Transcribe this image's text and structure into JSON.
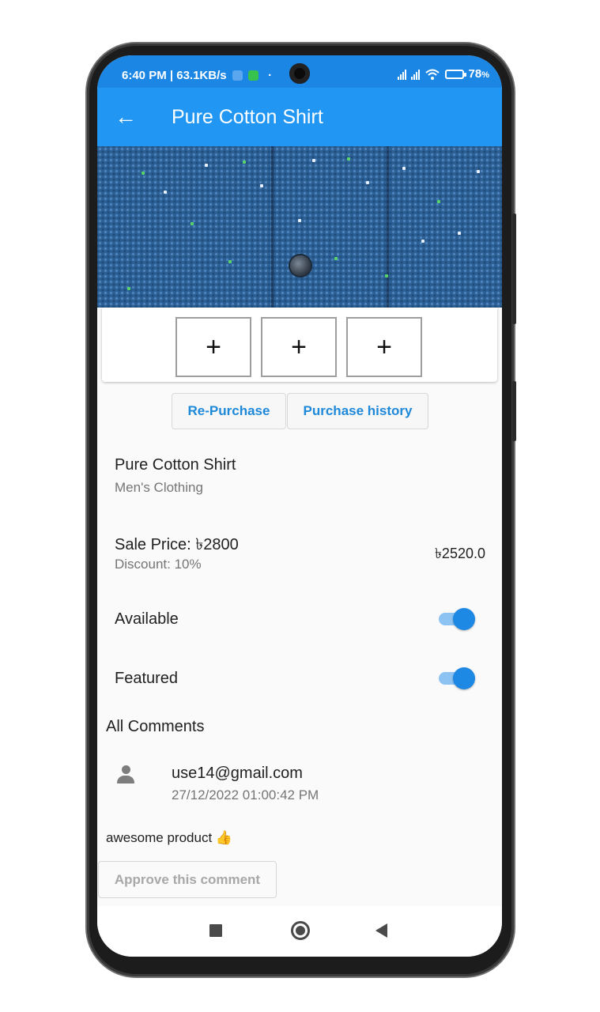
{
  "status_bar": {
    "time_speed": "6:40 PM | 63.1KB/s",
    "separator": "·",
    "battery_level": "78",
    "battery_unit": "%",
    "icons": [
      "notification-icon",
      "android-icon",
      "signal-icon",
      "wifi-icon",
      "battery-charging-icon"
    ]
  },
  "app_bar": {
    "title": "Pure Cotton Shirt",
    "background_color": "#2196f3"
  },
  "image_slots": [
    {
      "symbol": "+"
    },
    {
      "symbol": "+"
    },
    {
      "symbol": "+"
    }
  ],
  "actions": {
    "repurchase_label": "Re-Purchase",
    "history_label": "Purchase history"
  },
  "product": {
    "name": "Pure Cotton Shirt",
    "category": "Men's Clothing",
    "sale_price_label": "Sale Price: ৳2800",
    "discount_label": "Discount: 10%",
    "final_price": "৳2520.0"
  },
  "toggles": {
    "available": {
      "label": "Available",
      "on": true
    },
    "featured": {
      "label": "Featured",
      "on": true
    }
  },
  "comments": {
    "heading": "All Comments",
    "items": [
      {
        "email": "use14@gmail.com",
        "timestamp": "27/12/2022 01:00:42 PM",
        "text": "awesome product 👍",
        "approve_label": "Approve this comment"
      }
    ]
  },
  "theme": {
    "primary": "#2196f3",
    "status_bar": "#1b86e3",
    "accent": "#1e88e5",
    "link_text": "#1e88d9"
  }
}
